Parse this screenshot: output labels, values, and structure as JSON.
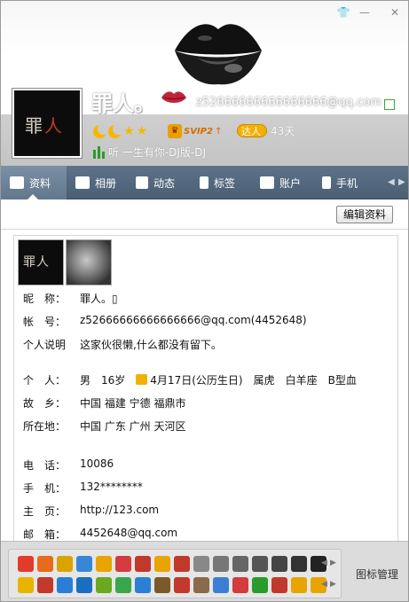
{
  "window": {
    "controls": [
      "shirt-icon",
      "minimize-icon",
      "restore-icon",
      "close-icon"
    ]
  },
  "profile": {
    "nickname": "罪人。",
    "email": "z52666666666666666@qq.com",
    "avatar_text_a": "罪",
    "avatar_text_b": "人",
    "level_icons": [
      "moon",
      "moon",
      "star",
      "star"
    ],
    "svip_label": "SVIP2",
    "svip_arrow": "↑",
    "daren_label": "达人",
    "daren_days": "43天",
    "music": "听 一生有你-DJ版-DJ"
  },
  "tabs": [
    {
      "label": "资料",
      "icon": "profile-card-icon",
      "active": true
    },
    {
      "label": "相册",
      "icon": "photo-album-icon",
      "active": false
    },
    {
      "label": "动态",
      "icon": "feed-list-icon",
      "active": false
    },
    {
      "label": "标签",
      "icon": "bookmark-tag-icon",
      "active": false
    },
    {
      "label": "账户",
      "icon": "wallet-icon",
      "active": false
    },
    {
      "label": "手机",
      "icon": "phone-icon",
      "active": false
    }
  ],
  "edit_button": "编辑资料",
  "info": {
    "nickname": {
      "label": "昵　称：",
      "value": "罪人。▯"
    },
    "account": {
      "label": "帐　号：",
      "value": "z52666666666666666@qq.com(4452648)"
    },
    "signature": {
      "label": "个人说明",
      "value": "这家伙很懒,什么都没有留下。"
    },
    "personal": {
      "label": "个　人：",
      "gender": "男",
      "age": "16岁",
      "birthday": "4月17日(公历生日)",
      "zodiac": "属虎",
      "constellation": "白羊座",
      "blood": "B型血"
    },
    "hometown": {
      "label": "故　乡：",
      "value": "中国 福建 宁德 福鼎市"
    },
    "location": {
      "label": "所在地：",
      "value": "中国 广东 广州 天河区"
    },
    "phone": {
      "label": "电　话：",
      "value": "10086"
    },
    "mobile": {
      "label": "手　机：",
      "value": "132********"
    },
    "homepage": {
      "label": "主　页：",
      "value": "http://123.com"
    },
    "mail": {
      "label": "邮　箱：",
      "value": "4452648@qq.com"
    }
  },
  "footer": {
    "manage_label": "图标管理",
    "colors_row1": [
      "#e23b2b",
      "#e86a1c",
      "#d9a400",
      "#3a86d6",
      "#e8a400",
      "#d23c3c",
      "#c0392b",
      "#e8a400",
      "#c0392b",
      "#888888",
      "#777777",
      "#666666",
      "#555555",
      "#444444",
      "#333333",
      "#222222"
    ],
    "colors_row2": [
      "#e8b400",
      "#c0392b",
      "#2a7fd4",
      "#1a6ec0",
      "#6aa820",
      "#3aa64a",
      "#2b7fd4",
      "#7a5a2a",
      "#c0392b",
      "#8a6a4a",
      "#3a7fd4",
      "#d23c3c",
      "#2a9a2a",
      "#c0392b",
      "#e8a400",
      "#e8a400"
    ]
  }
}
